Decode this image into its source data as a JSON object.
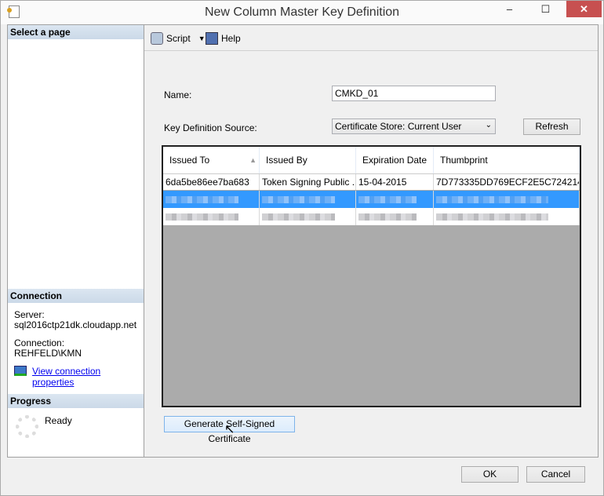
{
  "window": {
    "title": "New Column Master Key Definition",
    "minimize": "‒",
    "maximize": "☐",
    "close": "✕"
  },
  "left": {
    "select_page": "Select a page",
    "connection_header": "Connection",
    "server_label": "Server:",
    "server_value": "sql2016ctp21dk.cloudapp.net",
    "connection_label": "Connection:",
    "connection_value": "REHFELD\\KMN",
    "view_props": "View connection properties",
    "progress_header": "Progress",
    "progress_status": "Ready"
  },
  "toolbar": {
    "script": "Script",
    "help": "Help"
  },
  "form": {
    "name_label": "Name:",
    "name_value": "CMKD_01",
    "source_label": "Key Definition Source:",
    "source_value": "Certificate Store: Current User",
    "refresh": "Refresh"
  },
  "grid": {
    "headers": [
      "Issued To",
      "Issued By",
      "Expiration Date",
      "Thumbprint"
    ],
    "rows": [
      [
        "6da5be86ee7ba683",
        "Token Signing Public ...",
        "15-04-2015",
        "7D773335DD769ECF2E5C724214..."
      ]
    ]
  },
  "generate": "Generate Self-Signed Certificate",
  "ok": "OK",
  "cancel": "Cancel"
}
